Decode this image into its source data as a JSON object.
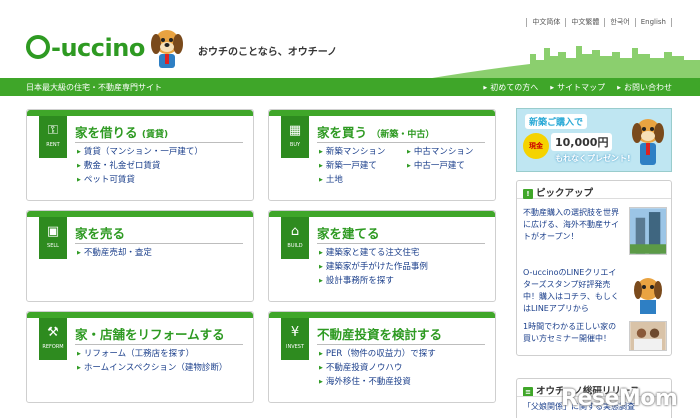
{
  "header": {
    "languages": [
      "中文简体",
      "中文繁體",
      "한국어",
      "English"
    ],
    "logo": "O-uccino",
    "tagline": "おウチのことなら、オウチーノ",
    "site_desc": "日本最大級の住宅・不動産専門サイト",
    "nav": [
      "初めての方へ",
      "サイトマップ",
      "お問い合わせ"
    ]
  },
  "cards": [
    {
      "icon_label": "RENT",
      "icon": "key-icon",
      "title": "家を借りる",
      "title_sub": "(賃貸)",
      "links": [
        "賃貸（マンション・一戸建て）",
        "敷金・礼金ゼロ賃貸",
        "ペット可賃貸"
      ]
    },
    {
      "icon_label": "BUY",
      "icon": "building-icon",
      "title": "家を買う",
      "title_sub": "（新築・中古）",
      "links": [
        "新築マンション",
        "中古マンション",
        "新築一戸建て",
        "中古一戸建て",
        "土地"
      ]
    },
    {
      "icon_label": "SELL",
      "icon": "sign-icon",
      "title": "家を売る",
      "title_sub": "",
      "links": [
        "不動産売却・査定"
      ]
    },
    {
      "icon_label": "BUILD",
      "icon": "house-icon",
      "title": "家を建てる",
      "title_sub": "",
      "links": [
        "建築家と建てる注文住宅",
        "建築家が手がけた作品事例",
        "設計事務所を探す"
      ]
    },
    {
      "icon_label": "REFORM",
      "icon": "tools-icon",
      "title": "家・店舗をリフォームする",
      "title_sub": "",
      "links": [
        "リフォーム（工務店を探す）",
        "ホームインスペクション（建物診断）"
      ]
    },
    {
      "icon_label": "INVEST",
      "icon": "chart-icon",
      "title": "不動産投資を検討する",
      "title_sub": "",
      "links": [
        "PER（物件の収益力）で探す",
        "不動産投資ノウハウ",
        "海外移住・不動産投資"
      ]
    }
  ],
  "banner": {
    "line1": "新築ご購入で",
    "cash": "現金",
    "amount": "10,000円",
    "line3": "もれなくプレゼント!"
  },
  "pickup": {
    "title": "ピックアップ",
    "items": [
      "不動産購入の選択肢を世界に広げる、海外不動産サイトがオープン！",
      "O-uccinoのLINEクリエイターズスタンプ好評発売中！購入はコチラ、もしくはLINEアプリから",
      "1時間でわかる正しい家の買い方セミナー開催中！"
    ]
  },
  "news": {
    "title": "オウチーノ総研リリース",
    "item": "「父娘関係」に関する実態調査"
  },
  "watermark": "ReseMom",
  "colors": {
    "brand_green": "#3fa629",
    "link_blue": "#1b3f8b"
  }
}
